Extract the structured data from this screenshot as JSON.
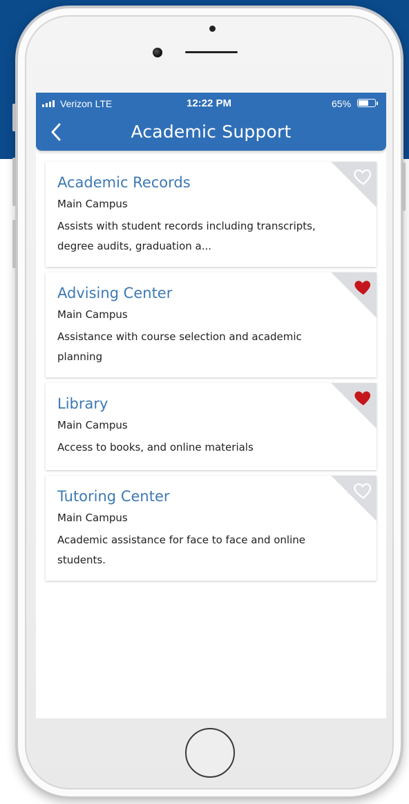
{
  "status_bar": {
    "carrier": "Verizon  LTE",
    "time": "12:22 PM",
    "battery_percent": "65%",
    "battery_level": 0.65
  },
  "header": {
    "title": "Academic Support",
    "back_icon": "chevron-left-icon"
  },
  "colors": {
    "header_blue": "#2f6fb7",
    "backdrop_blue": "#0b4a8b",
    "title_blue": "#3d79b4",
    "favorite_red": "#c4161c"
  },
  "cards": [
    {
      "title": "Academic Records",
      "campus": "Main Campus",
      "description": "Assists with student records including transcripts, degree audits, graduation a...",
      "favorited": false
    },
    {
      "title": "Advising Center",
      "campus": "Main Campus",
      "description": "Assistance with course selection and academic planning",
      "favorited": true
    },
    {
      "title": "Library",
      "campus": "Main Campus",
      "description": "Access to books, and online materials",
      "favorited": true
    },
    {
      "title": "Tutoring Center",
      "campus": "Main Campus",
      "description": "Academic assistance for face to face and online students.",
      "favorited": false
    }
  ]
}
